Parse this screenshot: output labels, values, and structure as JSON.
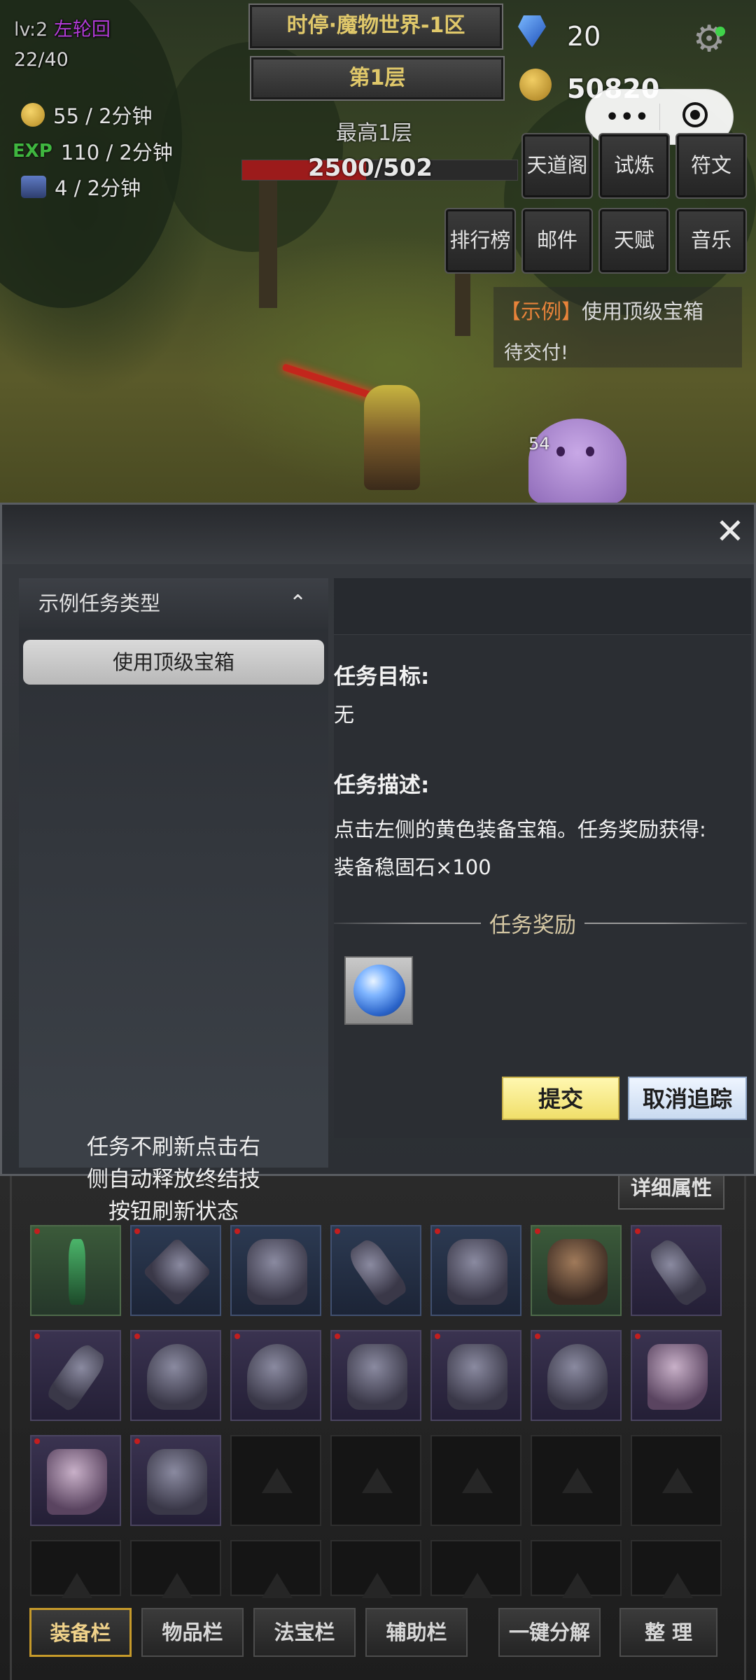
{
  "hud": {
    "level_text": "lv:2",
    "reincarnation": "左轮回",
    "stage_progress": "22/40",
    "gold_rate": "55 / 2分钟",
    "exp_tag": "EXP",
    "exp_rate": "110 / 2分钟",
    "chest_rate": "4 / 2分钟",
    "server_title": "时停·魔物世界-1区",
    "floor": "第1层",
    "best_floor": "最高1层",
    "hp_text": "2500/502",
    "hp_fraction": 0.45,
    "gems": "20",
    "gold": "50820",
    "float_damage": "54"
  },
  "menu": {
    "row1": [
      "天道阁",
      "试炼",
      "符文"
    ],
    "row2": [
      "排行榜",
      "邮件",
      "天赋",
      "音乐"
    ]
  },
  "capsule": {
    "more": "•••"
  },
  "quest_tracker": {
    "tag": "【示例】",
    "title": "使用顶级宝箱",
    "status": "待交付!"
  },
  "modal": {
    "close_glyph": "✕",
    "category_label": "示例任务类型",
    "category_chevron": "⌃",
    "task_item": "使用顶级宝箱",
    "left_note_lines": [
      "任务不刷新点击右",
      "侧自动释放终结技",
      "按钮刷新状态"
    ],
    "goal_heading": "任务目标:",
    "goal_value": "无",
    "desc_heading": "任务描述:",
    "desc_text": "点击左侧的黄色装备宝箱。任务奖励获得:装备稳固石×100",
    "reward_heading": "任务奖励",
    "submit_label": "提交",
    "cancel_label": "取消追踪"
  },
  "inventory": {
    "detail_label": "详细属性",
    "tabs": [
      "装备栏",
      "物品栏",
      "法宝栏",
      "辅助栏"
    ],
    "decompose_label": "一键分解",
    "sort_label": "整 理"
  },
  "colors": {
    "accent_gold": "#e0c86a",
    "reincarnation_purple": "#b13bd6",
    "exp_green": "#3fb63f",
    "submit_yellow": "#f0df6a",
    "cancel_blue": "#c9daf0"
  }
}
